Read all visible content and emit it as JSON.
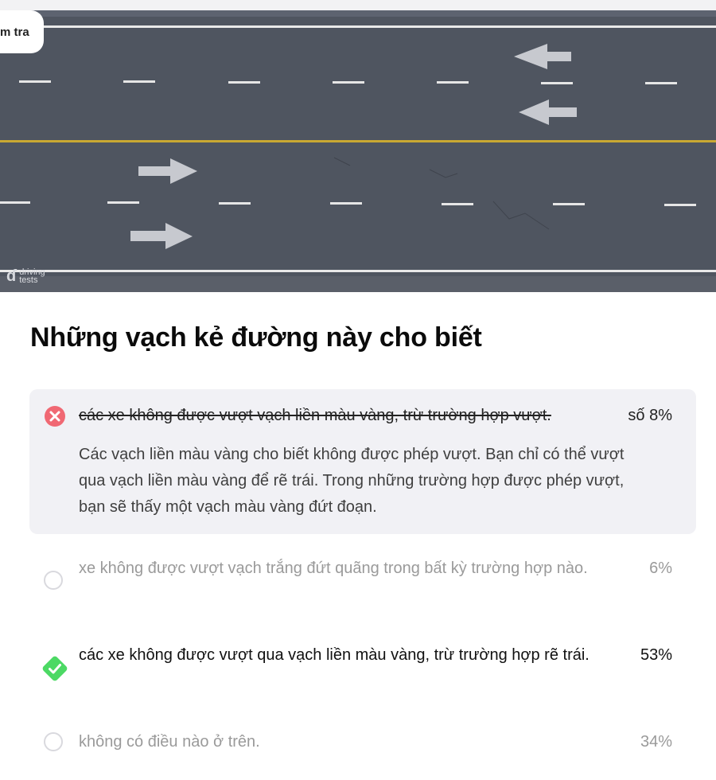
{
  "badge": {
    "label": "m tra"
  },
  "watermark": {
    "line1": "driving",
    "line2": "tests"
  },
  "question": {
    "title": "Những vạch kẻ đường này cho biết"
  },
  "answers": [
    {
      "text": "các xe không được vượt vạch liền màu vàng, trừ trường hợp vượt.",
      "percent": "số 8%",
      "state": "incorrect-selected",
      "explanation": "Các vạch liền màu vàng cho biết không được phép vượt. Bạn chỉ có thể vượt qua vạch liền màu vàng để rẽ trái. Trong những trường hợp được phép vượt, bạn sẽ thấy một vạch màu vàng đứt đoạn."
    },
    {
      "text": "xe không được vượt vạch trắng đứt quãng trong bất kỳ trường hợp nào.",
      "percent": "6%",
      "state": "unselected"
    },
    {
      "text": "các xe không được vượt qua vạch liền màu vàng, trừ trường hợp rẽ trái.",
      "percent": "53%",
      "state": "correct"
    },
    {
      "text": "không có điều nào ở trên.",
      "percent": "34%",
      "state": "unselected"
    }
  ],
  "colors": {
    "incorrect": "#f06873",
    "correct": "#4cd964",
    "surface": "#f1f1f5",
    "road": "#4f5560"
  }
}
